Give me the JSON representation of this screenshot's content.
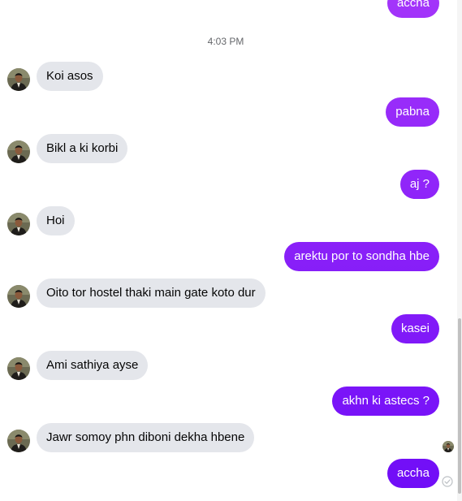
{
  "conversation": {
    "timestamp": "4:03 PM",
    "colors": {
      "outgoing_top": "#a334fa",
      "outgoing_bottom": "#6f0cf7",
      "incoming": "#e4e6eb"
    },
    "messages": [
      {
        "direction": "out",
        "text": "accha"
      },
      {
        "direction": "in",
        "text": "Koi asos"
      },
      {
        "direction": "out",
        "text": "pabna"
      },
      {
        "direction": "in",
        "text": "Bikl a ki korbi"
      },
      {
        "direction": "out",
        "text": "aj ?"
      },
      {
        "direction": "in",
        "text": "Hoi"
      },
      {
        "direction": "out",
        "text": "arektu por to sondha hbe"
      },
      {
        "direction": "in",
        "text": "Oito tor hostel thaki main gate koto dur"
      },
      {
        "direction": "out",
        "text": "kasei"
      },
      {
        "direction": "in",
        "text": "Ami sathiya ayse"
      },
      {
        "direction": "out",
        "text": "akhn ki astecs ?"
      },
      {
        "direction": "in",
        "text": "Jawr somoy phn diboni dekha hbene"
      },
      {
        "direction": "out",
        "text": "accha"
      }
    ],
    "icons": {
      "avatar": "contact-avatar-icon",
      "seen": "seen-avatar-icon",
      "sent": "sent-check-icon"
    }
  }
}
